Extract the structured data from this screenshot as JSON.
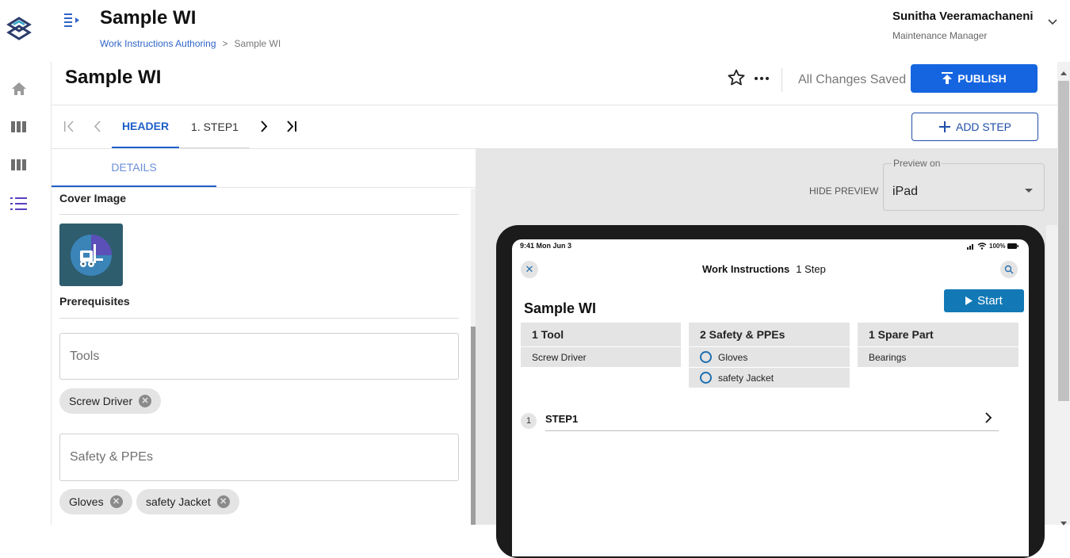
{
  "header": {
    "title": "Sample WI",
    "breadcrumb": {
      "parent": "Work Instructions Authoring",
      "separator": ">",
      "current": "Sample WI"
    },
    "user": {
      "name": "Sunitha Veeramachaneni",
      "role": "Maintenance Manager"
    }
  },
  "rail": {
    "icons": [
      "logo-icon",
      "home-icon",
      "columns-icon",
      "columns-icon",
      "list-icon"
    ]
  },
  "editor": {
    "title": "Sample WI",
    "save_status": "All Changes Saved",
    "publish_label": "PUBLISH",
    "add_step_label": "ADD STEP",
    "tabs": [
      {
        "label": "HEADER",
        "active": true
      },
      {
        "label": "1. STEP1",
        "active": false
      }
    ]
  },
  "details": {
    "tab_label": "DETAILS",
    "cover_image_label": "Cover Image",
    "prerequisites_label": "Prerequisites",
    "tools_placeholder": "Tools",
    "tools_chips": [
      "Screw Driver"
    ],
    "safety_placeholder": "Safety & PPEs",
    "safety_chips": [
      "Gloves",
      "safety Jacket"
    ]
  },
  "preview": {
    "hide_label": "HIDE PREVIEW",
    "preview_on_label": "Preview on",
    "device": "iPad",
    "statusbar": {
      "time": "9:41 Mon Jun 3",
      "battery": "100%"
    },
    "nav_title": "Work Instructions",
    "nav_steps": "1 Step",
    "wi_title": "Sample WI",
    "start_label": "Start",
    "cards": [
      {
        "title": "1 Tool",
        "items": [
          "Screw Driver"
        ],
        "radio": false
      },
      {
        "title": "2 Safety & PPEs",
        "items": [
          "Gloves",
          "safety Jacket"
        ],
        "radio": true
      },
      {
        "title": "1 Spare Part",
        "items": [
          "Bearings"
        ],
        "radio": false
      }
    ],
    "step": {
      "number": "1",
      "name": "STEP1"
    }
  },
  "colors": {
    "primary": "#1565e0",
    "accent_blue": "#1f6fb0",
    "start": "#1279b6"
  }
}
